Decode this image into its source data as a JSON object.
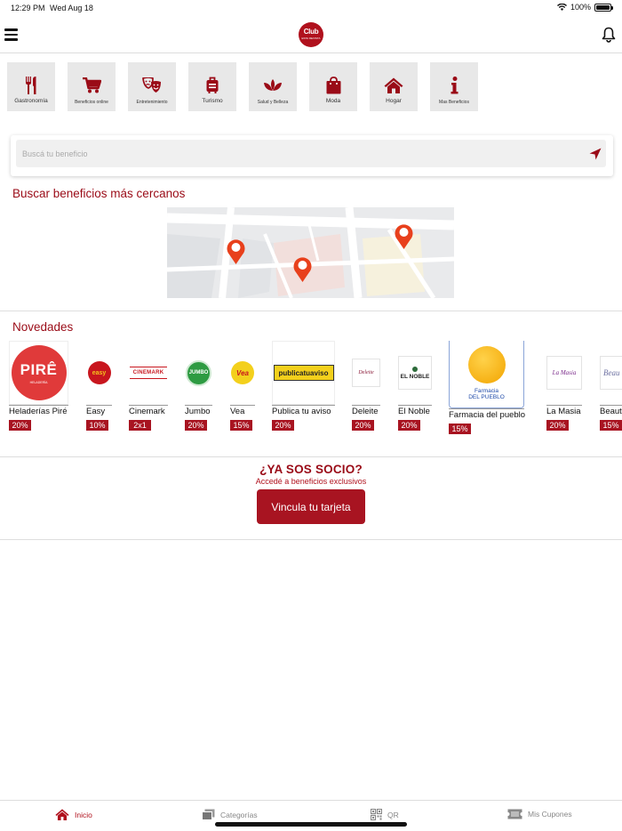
{
  "status_bar": {
    "time": "12:29 PM",
    "date": "Wed Aug 18",
    "battery": "100%"
  },
  "header": {
    "logo_line1": "Club",
    "logo_line2": "ESTA REVISTA"
  },
  "categories": [
    {
      "label": "Gastronomía",
      "icon": "fork-knife-icon"
    },
    {
      "label": "Beneficios online",
      "icon": "cart-icon"
    },
    {
      "label": "Entretenimiento",
      "icon": "theater-masks-icon"
    },
    {
      "label": "Turismo",
      "icon": "suitcase-icon"
    },
    {
      "label": "Salud y Belleza",
      "icon": "lotus-icon"
    },
    {
      "label": "Moda",
      "icon": "shopping-bag-icon"
    },
    {
      "label": "Hogar",
      "icon": "home-icon"
    },
    {
      "label": "Mas Beneficios",
      "icon": "info-icon"
    }
  ],
  "search": {
    "placeholder": "Buscá tu beneficio"
  },
  "nearby": {
    "title": "Buscar beneficios más cercanos"
  },
  "novedades": {
    "title": "Novedades",
    "brands": [
      {
        "name": "Heladerías Piré",
        "discount": "20%",
        "logo_text": "PIRÊ",
        "logo_sub": "HELADERÍA"
      },
      {
        "name": "Easy",
        "discount": "10%",
        "logo_text": "easy"
      },
      {
        "name": "Cinemark",
        "discount": "2x1",
        "logo_text": "CINEMARK"
      },
      {
        "name": "Jumbo",
        "discount": "20%",
        "logo_text": "JUMBO"
      },
      {
        "name": "Vea",
        "discount": "15%",
        "logo_text": "Vea"
      },
      {
        "name": "Publica tu aviso",
        "discount": "20%",
        "logo_text": "publicatuaviso"
      },
      {
        "name": "Deleite",
        "discount": "20%",
        "logo_text": "Deleite"
      },
      {
        "name": "El Noble",
        "discount": "20%",
        "logo_text": "EL NOBLE"
      },
      {
        "name": "Farmacia del pueblo",
        "discount": "15%",
        "logo_text": "Farmacia",
        "logo_sub": "DEL PUEBLO"
      },
      {
        "name": "La Masia",
        "discount": "20%",
        "logo_text": "La Masia"
      },
      {
        "name": "Beaut",
        "discount": "15%",
        "logo_text": "Beau"
      }
    ]
  },
  "socio": {
    "question": "¿YA SOS SOCIO?",
    "subtitle": "Accedé a beneficios exclusivos",
    "button": "Vincula tu tarjeta"
  },
  "tabs": [
    {
      "label": "Inicio",
      "icon": "home-icon",
      "active": true
    },
    {
      "label": "Categorías",
      "icon": "cards-icon",
      "active": false
    },
    {
      "label": "QR",
      "icon": "qr-icon",
      "active": false
    },
    {
      "label": "Mis Cupones",
      "icon": "ticket-icon",
      "active": false
    }
  ],
  "colors": {
    "brand_red": "#a81421",
    "title_red": "#9a0b17",
    "tile_gray": "#e8e8e8"
  }
}
